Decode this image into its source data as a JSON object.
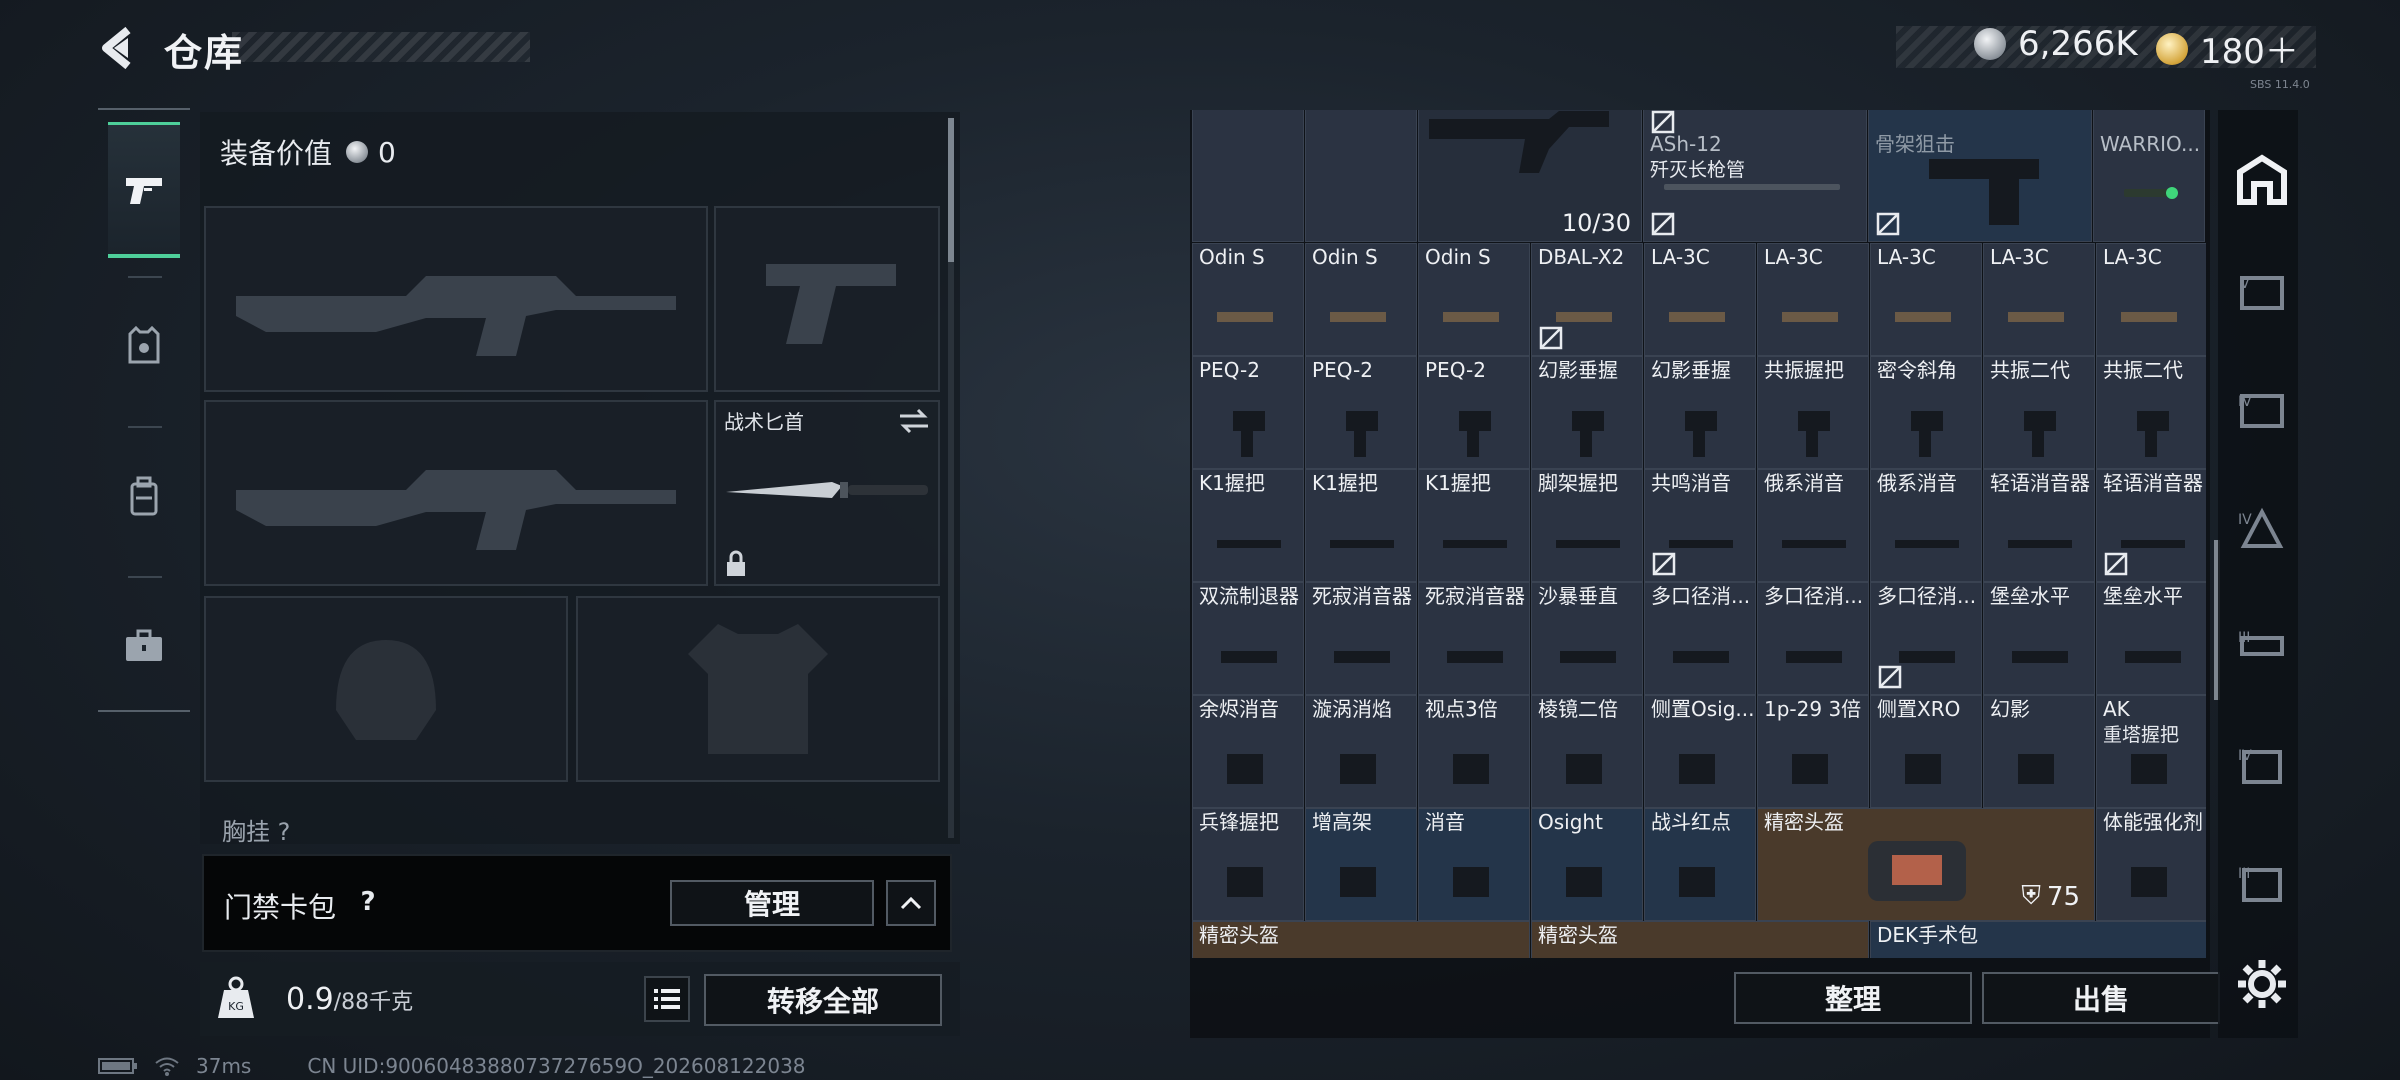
{
  "header": {
    "title": "仓库"
  },
  "currency": {
    "silver": "6,266K",
    "gold": "180＋"
  },
  "tiny_text": "SBS 11.4.0",
  "loadout": {
    "equip_value_label": "装备价值",
    "equip_value": "0",
    "knife_label": "战术匕首",
    "chest_label": "胸挂 ?"
  },
  "keycard": {
    "label": "门禁卡包",
    "help": "?",
    "manage": "管理"
  },
  "weight": {
    "value": "0.9",
    "max": "/88千克",
    "transfer_all": "转移全部"
  },
  "status": {
    "ping": "37ms",
    "uid": "CN UID:9006048388073727659O_202608122038"
  },
  "stash": {
    "top_row": [
      {
        "name": "",
        "sub": ""
      },
      {
        "name": "",
        "sub": ""
      },
      {
        "name": "",
        "sub": "",
        "count": "10/30"
      },
      {
        "name": "ASh-12",
        "sub": "歼灭长枪管"
      },
      {
        "name": "",
        "sub": ""
      },
      {
        "name": "骨架狙击",
        "sub": ""
      },
      {
        "name": "",
        "sub": ""
      },
      {
        "name": "WARRIO...",
        "sub": ""
      }
    ],
    "rows": [
      [
        "Odin S",
        "Odin S",
        "Odin S",
        "DBAL-X2",
        "LA-3C",
        "LA-3C",
        "LA-3C",
        "LA-3C",
        "LA-3C"
      ],
      [
        "PEQ-2",
        "PEQ-2",
        "PEQ-2",
        "幻影垂握",
        "幻影垂握",
        "共振握把",
        "密令斜角",
        "共振二代",
        "共振二代"
      ],
      [
        "K1握把",
        "K1握把",
        "K1握把",
        "脚架握把",
        "共鸣消音",
        "俄系消音",
        "俄系消音",
        "轻语消音器",
        "轻语消音器"
      ],
      [
        "双流制退器",
        "死寂消音器",
        "死寂消音器",
        "沙暴垂直",
        "多口径消...",
        "多口径消...",
        "多口径消...",
        "堡垒水平",
        "堡垒水平"
      ],
      [
        "余烬消音",
        "漩涡消焰",
        "视点3倍",
        "棱镜二倍",
        "侧置Osig...",
        "1p-29 3倍",
        "侧置XRO",
        "幻影",
        "AK"
      ],
      [
        "兵锋握把",
        "增高架",
        "消音",
        "Osight",
        "战斗红点",
        "精密头盔",
        "",
        "",
        "体能强化剂"
      ],
      [
        "精密头盔",
        "",
        "",
        "精密头盔",
        "",
        "",
        "DEK手术包",
        "",
        ""
      ]
    ],
    "ak_sub": "重塔握把",
    "helmet_armor": "75",
    "sort_button": "整理",
    "sell_button": "出售"
  },
  "colors": {
    "accent": "#4ecf9a",
    "cell": "#2b3342",
    "teal_cell": "#24354a",
    "brown_cell": "#4a3a2b"
  }
}
